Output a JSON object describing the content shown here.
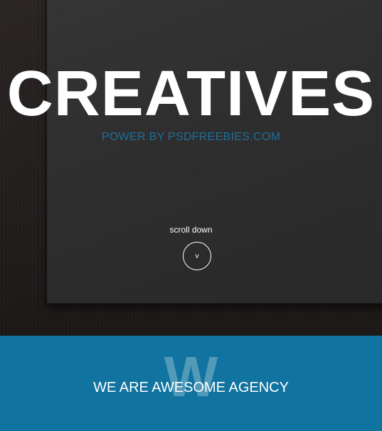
{
  "hero": {
    "title": "CREATIVES",
    "subtitle": "POWER BY PSDFREEBIES.COM",
    "scroll_label": "scroll down",
    "scroll_icon": "v"
  },
  "agency": {
    "watermark": "W",
    "heading": "WE ARE AWESOME AGENCY"
  },
  "colors": {
    "accent": "#11739f",
    "subtitle": "#1e6f9a",
    "hero_bg": "#2f2e2e",
    "text": "#ffffff"
  }
}
